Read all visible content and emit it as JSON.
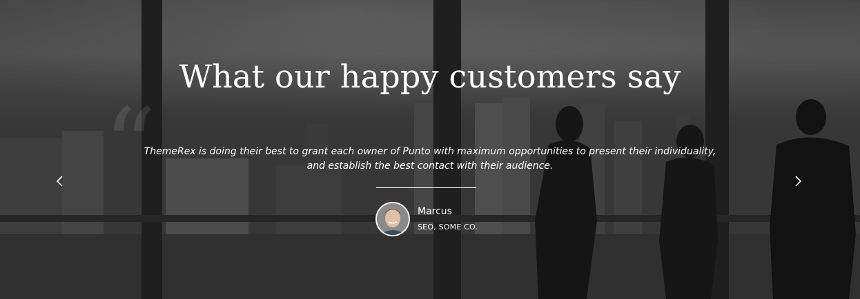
{
  "testimonials": {
    "title": "What our happy customers say",
    "quote_text": "ThemeRex is doing their best to grant each owner of Punto with maximum opportunities to present their individuality, and establish the best contact with their audience.",
    "author": {
      "name": "Marcus",
      "role": "SEO, SOME CO."
    },
    "quote_mark": "“",
    "icons": {
      "prev": "chevron-left-icon",
      "next": "chevron-right-icon"
    },
    "colors": {
      "text": "#ffffff",
      "overlay": "#2e2e2e"
    }
  }
}
